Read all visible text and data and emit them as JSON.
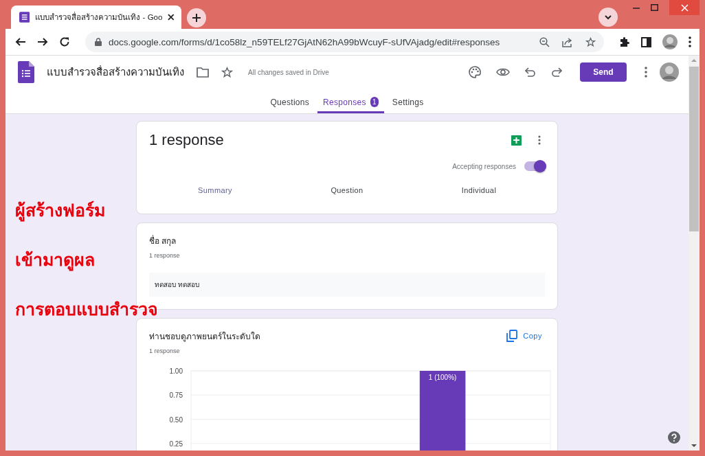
{
  "browser": {
    "tab_title": "แบบสำรวจสื่อสร้างความบันเทิง - Goo",
    "address": "docs.google.com/forms/d/1co58lz_n59TELf27GjAtN62hA99bWcuyF-sUfVAjadg/edit#responses"
  },
  "form_header": {
    "title": "แบบสำรวจสื่อสร้างความบันเทิง",
    "save_status": "All changes saved in Drive",
    "send_button": "Send"
  },
  "tabs": [
    {
      "label": "Questions",
      "selected": false
    },
    {
      "label": "Responses",
      "badge": "1",
      "selected": true
    },
    {
      "label": "Settings",
      "selected": false
    }
  ],
  "summary": {
    "heading": "1 response",
    "accepting_label": "Accepting responses",
    "accepting_on": true,
    "view_tabs": [
      {
        "label": "Summary",
        "selected": true
      },
      {
        "label": "Question",
        "selected": false
      },
      {
        "label": "Individual",
        "selected": false
      }
    ]
  },
  "questions": [
    {
      "kind": "text",
      "title": "ชื่อ สกุล",
      "count": "1 response",
      "answers": [
        "ทดสอบ ทดสอบ"
      ]
    },
    {
      "kind": "chart",
      "title": "ท่านชอบดูภาพยนตร์ในระดับใด",
      "count": "1 response",
      "copy_label": "Copy",
      "chart_data": {
        "type": "bar",
        "grid": true,
        "values": [
          0,
          0,
          0,
          1,
          0
        ],
        "ylim": [
          0,
          1
        ],
        "yticks": [
          {
            "value": 1,
            "label": "1.00"
          },
          {
            "value": 0.75,
            "label": "0.75"
          },
          {
            "value": 0.5,
            "label": "0.50"
          },
          {
            "value": 0.25,
            "label": "0.25"
          }
        ],
        "value_labels": [
          null,
          null,
          null,
          "1 (100%)",
          null
        ]
      }
    }
  ],
  "annotations": [
    "ผู้สร้างฟอร์ม",
    "เข้ามาดูผล",
    "การตอบแบบสำรวจ"
  ]
}
